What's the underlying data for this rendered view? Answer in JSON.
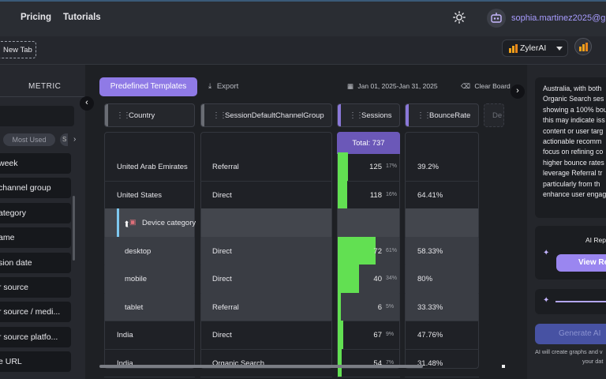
{
  "nav": {
    "pricing": "Pricing",
    "tutorials": "Tutorials",
    "email": "sophia.martinez2025@g"
  },
  "subbar": {
    "new_tab": "New Tab",
    "model": "ZylerAI"
  },
  "left_panel": {
    "tab": "METRIC",
    "chips": {
      "most_used": "Most Used",
      "cut_chip": "S"
    },
    "dimensions": [
      "week",
      "channel group",
      "ategory",
      "ame",
      "sion date",
      "r source",
      "r source / medi...",
      "r source platfo...",
      "e URL"
    ]
  },
  "toolbar": {
    "predefined": "Predefined Templates",
    "export": "Export",
    "date_range": "Jan 01, 2025-Jan 31, 2025",
    "clear": "Clear Board"
  },
  "columns": [
    "Country",
    "SessionDefaultChannelGroup",
    "Sessions",
    "BounceRate",
    "De"
  ],
  "total": "Total: 737",
  "rows": [
    {
      "country": "United Arab Emirates",
      "channel": "Referral",
      "sessions": "125",
      "pct": "17%",
      "share": 0.17,
      "bounce": "39.2%"
    },
    {
      "country": "United States",
      "channel": "Direct",
      "sessions": "118",
      "pct": "16%",
      "share": 0.16,
      "bounce": "64.41%"
    },
    {
      "country": "Device category",
      "channel": "",
      "sessions": "",
      "pct": "",
      "share": 0,
      "bounce": ""
    },
    {
      "country": "desktop",
      "channel": "Direct",
      "sessions": "72",
      "pct": "61%",
      "share": 0.61,
      "bounce": "58.33%"
    },
    {
      "country": "mobile",
      "channel": "Direct",
      "sessions": "40",
      "pct": "34%",
      "share": 0.34,
      "bounce": "80%"
    },
    {
      "country": "tablet",
      "channel": "Referral",
      "sessions": "6",
      "pct": "5%",
      "share": 0.05,
      "bounce": "33.33%"
    },
    {
      "country": "India",
      "channel": "Direct",
      "sessions": "67",
      "pct": "9%",
      "share": 0.09,
      "bounce": "47.76%"
    },
    {
      "country": "India",
      "channel": "Organic Search",
      "sessions": "54",
      "pct": "7%",
      "share": 0.07,
      "bounce": "31.48%"
    }
  ],
  "right_panel": {
    "insight_lines": [
      "Australia, with both",
      "Organic Search ses",
      "showing a 100% bou",
      "this may indicate iss",
      "content or user targ",
      "actionable recomm",
      "focus on refining co",
      "higher bounce rates",
      "leverage Referral tr",
      "particularly from th",
      "enhance user engag"
    ],
    "ai_report_title": "AI Rep",
    "view_report": "View Re",
    "generate": "Generate AI",
    "note_lines": [
      "AI will create graphs and v",
      "your dat"
    ]
  },
  "colors": {
    "accent": "#8f7ae6",
    "bar": "#62e052",
    "total": "#6b58b8"
  }
}
